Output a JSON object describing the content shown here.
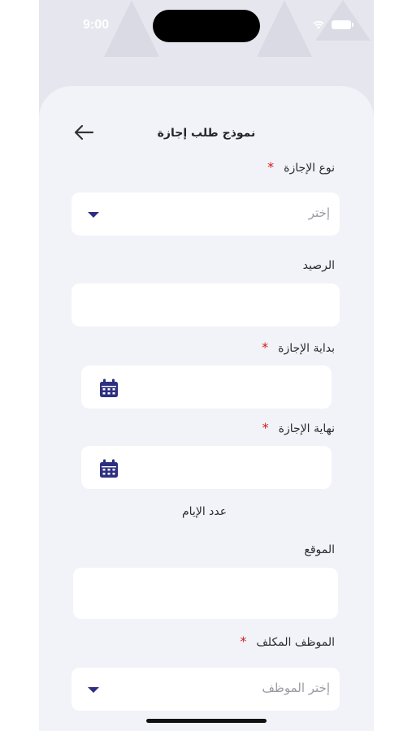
{
  "status_bar": {
    "time": "9:00"
  },
  "header": {
    "title": "نموذج طلب إجازة"
  },
  "form": {
    "leave_type": {
      "label": "نوع الإجازة",
      "placeholder": "إختر"
    },
    "balance": {
      "label": "الرصيد",
      "value": ""
    },
    "leave_start": {
      "label": "بداية الإجازة",
      "value": ""
    },
    "leave_end": {
      "label": "نهاية الإجازة",
      "value": ""
    },
    "days_count": {
      "label": "عدد الإيام"
    },
    "location": {
      "label": "الموقع",
      "value": ""
    },
    "assigned_employee": {
      "label": "الموظف المكلف",
      "placeholder": "إختر الموظف"
    },
    "required_mark": "*"
  },
  "colors": {
    "accent": "#2e2f80",
    "required": "#d11b1b",
    "card": "#f2f3f8"
  }
}
